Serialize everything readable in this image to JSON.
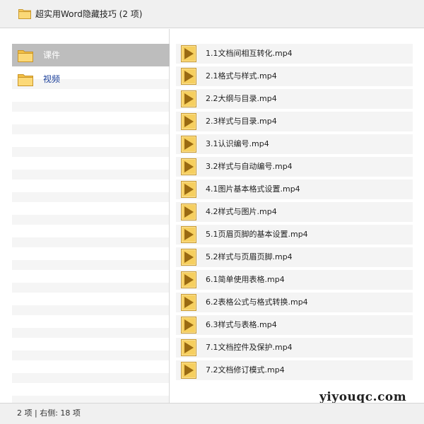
{
  "window": {
    "title": "超实用Word隐藏技巧 (2 项)",
    "icon": "folder-icon"
  },
  "sidebar": {
    "items": [
      {
        "label": "课件",
        "icon": "folder-icon",
        "selected": true
      },
      {
        "label": "视频",
        "icon": "folder-icon",
        "selected": false
      }
    ]
  },
  "files": [
    {
      "name": "1.1文档间相互转化.mp4",
      "icon": "video-file-icon"
    },
    {
      "name": "2.1格式与样式.mp4",
      "icon": "video-file-icon"
    },
    {
      "name": "2.2大纲与目录.mp4",
      "icon": "video-file-icon"
    },
    {
      "name": "2.3样式与目录.mp4",
      "icon": "video-file-icon"
    },
    {
      "name": "3.1认识编号.mp4",
      "icon": "video-file-icon"
    },
    {
      "name": "3.2样式与自动编号.mp4",
      "icon": "video-file-icon"
    },
    {
      "name": "4.1图片基本格式设置.mp4",
      "icon": "video-file-icon"
    },
    {
      "name": "4.2样式与图片.mp4",
      "icon": "video-file-icon"
    },
    {
      "name": "5.1页眉页脚的基本设置.mp4",
      "icon": "video-file-icon"
    },
    {
      "name": "5.2样式与页眉页脚.mp4",
      "icon": "video-file-icon"
    },
    {
      "name": "6.1简单使用表格.mp4",
      "icon": "video-file-icon"
    },
    {
      "name": "6.2表格公式与格式转换.mp4",
      "icon": "video-file-icon"
    },
    {
      "name": "6.3样式与表格.mp4",
      "icon": "video-file-icon"
    },
    {
      "name": "7.1文档控件及保护.mp4",
      "icon": "video-file-icon"
    },
    {
      "name": "7.2文档修订模式.mp4",
      "icon": "video-file-icon"
    }
  ],
  "status": {
    "text": "2 项 | 右侧: 18 项"
  },
  "watermark": "yiyouqc.com",
  "colors": {
    "selected_bg": "#bdbdbd",
    "folder_yellow": "#f7c95a",
    "play_brown": "#9a6a12",
    "link_blue": "#1a3f9a"
  }
}
